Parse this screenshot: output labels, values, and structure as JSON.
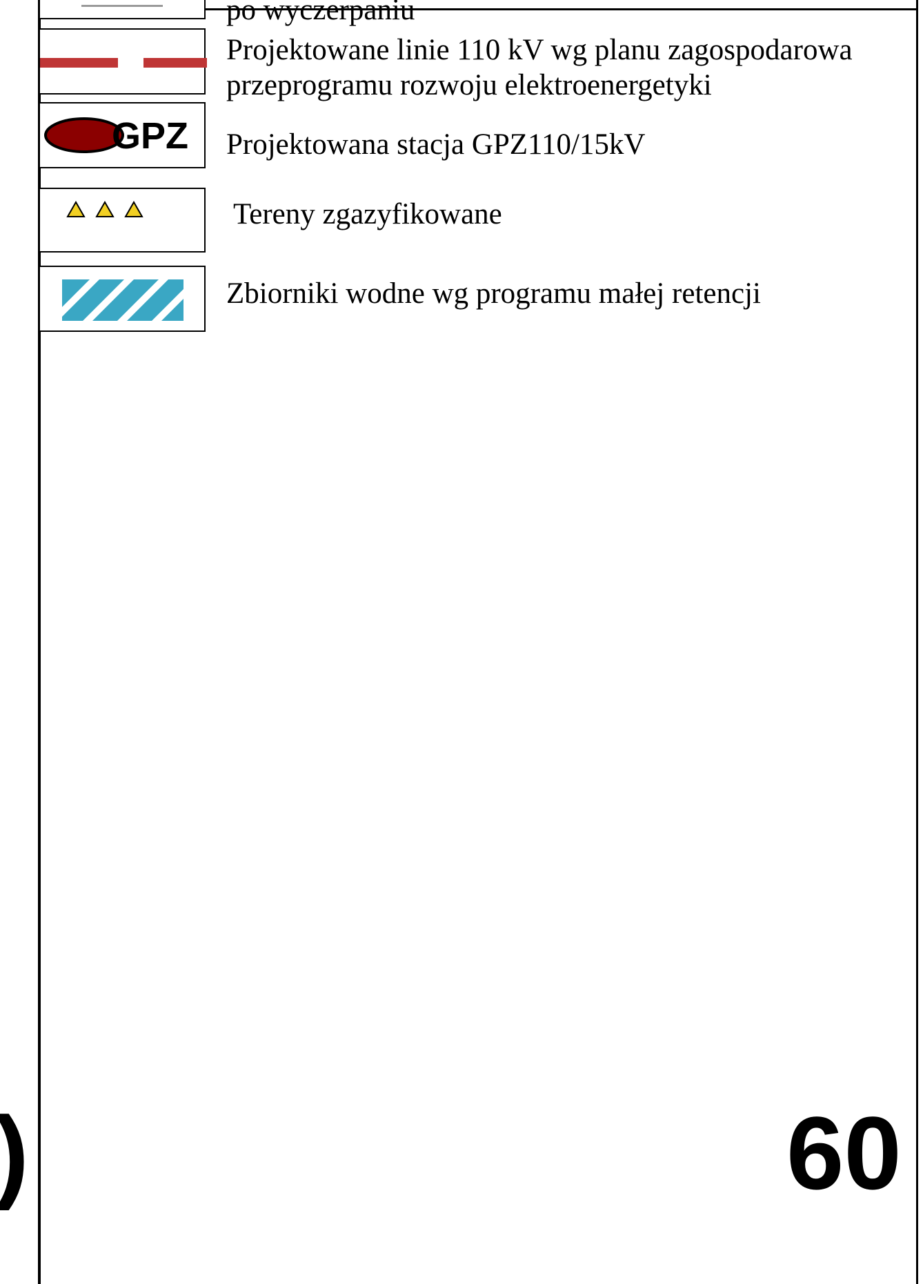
{
  "legend": {
    "items": [
      {
        "id": "item-existing-lines",
        "text": "po wyczerpaniu"
      },
      {
        "id": "item-projected-110kv",
        "text_lines": [
          "Projektowane linie 110 kV wg planu zagospodarowa",
          "przeprogramu rozwoju elektroenergetyki"
        ],
        "color": "#bf3535"
      },
      {
        "id": "item-gpz-station",
        "text": "Projektowana stacja GPZ110/15kV",
        "symbol_label": "GPZ",
        "color": "#8b0000"
      },
      {
        "id": "item-gasified-areas",
        "text": "Tereny zgazyfikowane",
        "color": "#f2d023"
      },
      {
        "id": "item-water-reservoirs",
        "text": "Zbiorniki wodne wg programu małej retencji",
        "color": "#3aa7c4"
      }
    ]
  },
  "page_number": "60",
  "left_fragment": ")"
}
